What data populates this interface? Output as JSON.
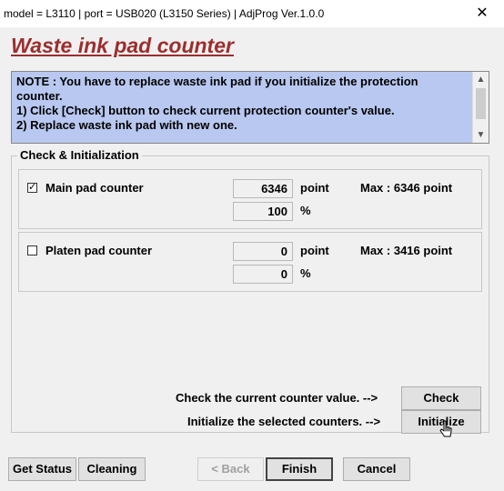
{
  "window": {
    "title": "model = L3110 | port = USB020 (L3150 Series) | AdjProg Ver.1.0.0",
    "close_glyph": "✕"
  },
  "heading": "Waste ink pad counter",
  "note": {
    "text": "NOTE : You have to replace waste ink pad if you initialize the protection\ncounter.\n1) Click [Check] button to check current protection counter's value.\n2) Replace waste ink pad with new one."
  },
  "group": {
    "legend": "Check & Initialization",
    "main_pad": {
      "checked": true,
      "check_glyph": "✓",
      "label": "Main pad counter",
      "point_value": "6346",
      "point_unit": "point",
      "max_text": "Max : 6346 point",
      "percent_value": "100",
      "percent_unit": "%"
    },
    "platen_pad": {
      "checked": false,
      "check_glyph": "",
      "label": "Platen pad counter",
      "point_value": "0",
      "point_unit": "point",
      "max_text": "Max : 3416 point",
      "percent_value": "0",
      "percent_unit": "%"
    },
    "check_prompt": "Check the current counter value. -->",
    "check_button": "Check",
    "init_prompt": "Initialize the selected counters. -->",
    "init_button": "Initialize"
  },
  "footer": {
    "get_status": "Get Status",
    "cleaning": "Cleaning",
    "back": "< Back",
    "finish": "Finish",
    "cancel": "Cancel"
  },
  "colors": {
    "heading": "#9c2e2e",
    "note_background": "#b9c8f0",
    "window_background": "#f0f0f0"
  }
}
